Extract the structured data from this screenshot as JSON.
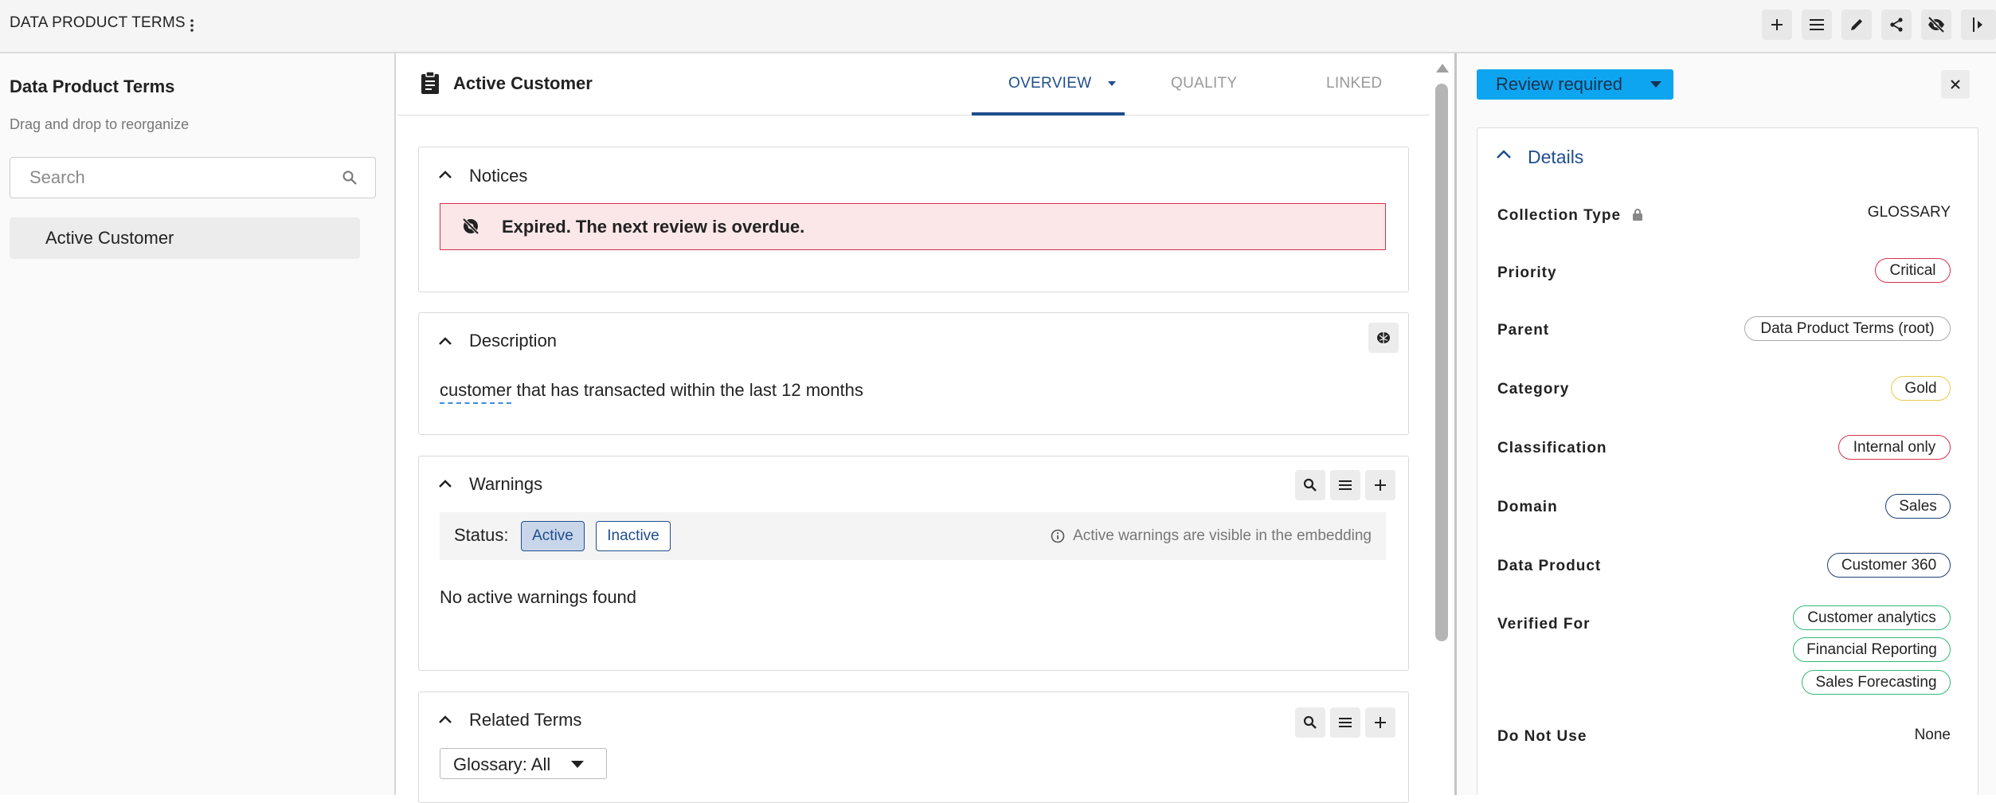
{
  "app": {
    "title": "DATA PRODUCT TERMS"
  },
  "sidebar": {
    "title": "Data Product Terms",
    "subtitle": "Drag and drop to reorganize",
    "search_placeholder": "Search",
    "items": [
      {
        "label": "Active Customer",
        "selected": true
      }
    ]
  },
  "main": {
    "title": "Active Customer",
    "tabs": [
      {
        "label": "OVERVIEW",
        "active": true
      },
      {
        "label": "QUALITY",
        "active": false
      },
      {
        "label": "LINKED",
        "active": false
      }
    ],
    "notices": {
      "title": "Notices",
      "message": "Expired. The next review is overdue."
    },
    "description": {
      "title": "Description",
      "link_word": "customer",
      "text": "that has transacted within the last 12 months"
    },
    "warnings": {
      "title": "Warnings",
      "status_label": "Status:",
      "filters": [
        {
          "label": "Active",
          "selected": true
        },
        {
          "label": "Inactive",
          "selected": false
        }
      ],
      "info": "Active warnings are visible in the embedding",
      "empty": "No active warnings found"
    },
    "related": {
      "title": "Related Terms",
      "dropdown": "Glossary: All"
    }
  },
  "panel": {
    "review_label": "Review required",
    "details_title": "Details",
    "rows": {
      "collection_type": {
        "label": "Collection Type",
        "value": "GLOSSARY"
      },
      "priority": {
        "label": "Priority",
        "value": "Critical"
      },
      "parent": {
        "label": "Parent",
        "value": "Data Product Terms (root)"
      },
      "category": {
        "label": "Category",
        "value": "Gold"
      },
      "classification": {
        "label": "Classification",
        "value": "Internal only"
      },
      "domain": {
        "label": "Domain",
        "value": "Sales"
      },
      "data_product": {
        "label": "Data Product",
        "value": "Customer 360"
      },
      "verified_for": {
        "label": "Verified For",
        "values": [
          "Customer analytics",
          "Financial Reporting",
          "Sales Forecasting"
        ]
      },
      "do_not_use": {
        "label": "Do Not Use",
        "value": "None"
      }
    }
  },
  "colors": {
    "accent": "#1f4e8c",
    "review_button": "#0ea5f0",
    "notice_bg": "#fbe6e8",
    "notice_border": "#d8304b",
    "tag_red": "#d8304b",
    "tag_gold": "#e6c84a",
    "tag_navy": "#1f3f73",
    "tag_green": "#33b877"
  },
  "icons": [
    "kebab-icon",
    "add-icon",
    "menu-icon",
    "edit-icon",
    "share-icon",
    "visibility-off-icon",
    "collapse-panel-icon",
    "search-icon",
    "document-icon",
    "chevron-up-icon",
    "brain-icon",
    "info-icon",
    "close-icon",
    "lock-icon"
  ]
}
